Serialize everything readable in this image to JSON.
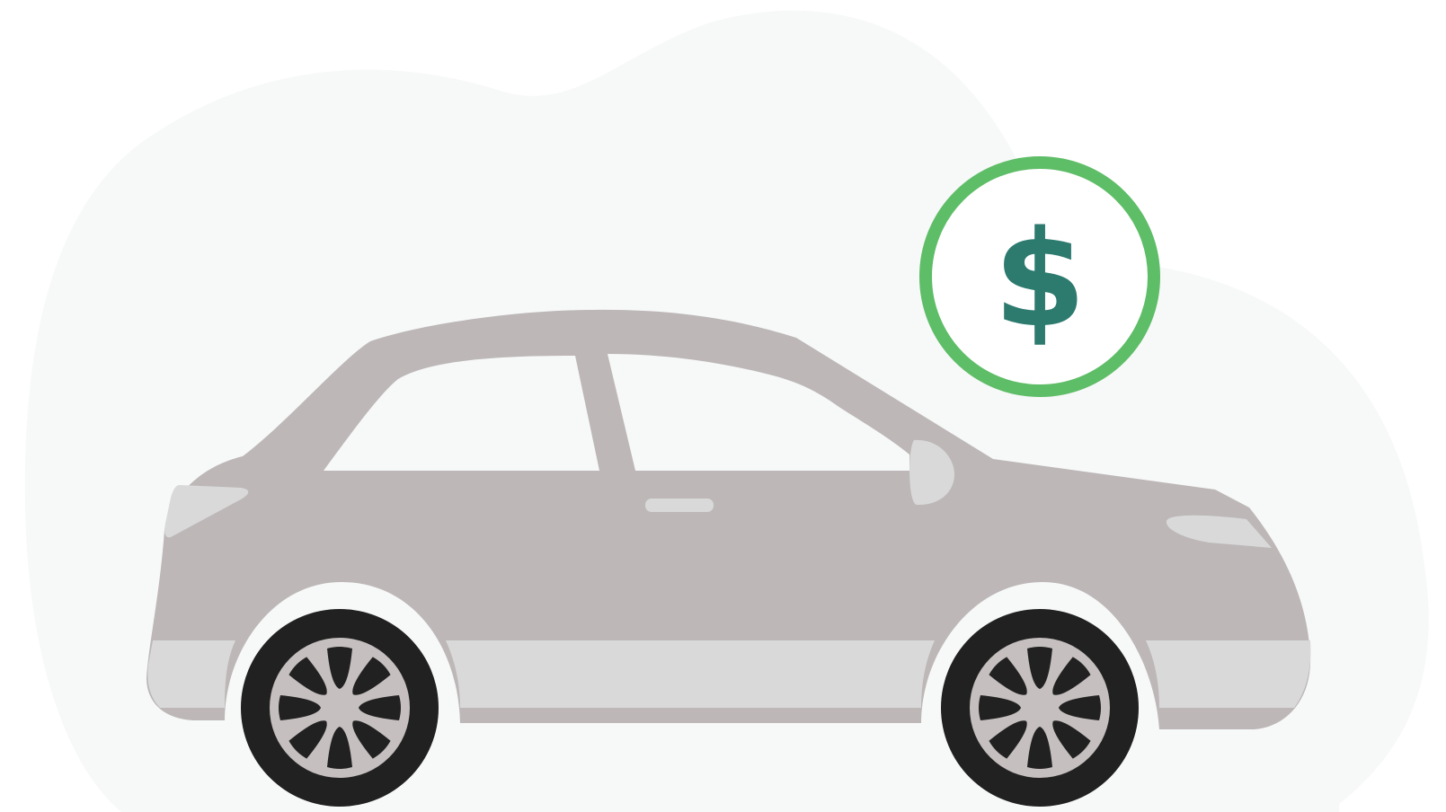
{
  "illustration": {
    "subject": "car-icon",
    "badge_icon": "dollar-icon",
    "badge_text": "$",
    "colors": {
      "background_blob": "#f7f8f8",
      "car_body": "#bdb7b7",
      "car_trim": "#d9d9d9",
      "windows": "#f7f8f8",
      "tire": "#222121",
      "rim": "#c5bfbf",
      "badge_ring": "#5ebd67",
      "badge_fill": "#ffffff",
      "dollar": "#2d7a6f"
    }
  }
}
